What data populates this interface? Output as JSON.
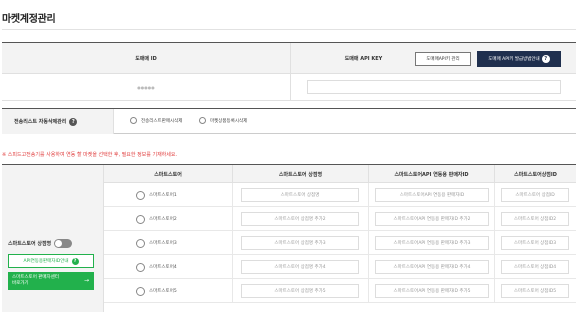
{
  "page": {
    "title": "마켓계정관리"
  },
  "domaemae": {
    "id_header": "도매매 ID",
    "apikey_header": "도매매 API KEY",
    "apikey_manage_button": "도매매API키 관리",
    "apikey_guide_button": "도매매 API키 발급방법안내",
    "id_value": "●●●●●",
    "apikey_value": ""
  },
  "auto_delete": {
    "label": "전송리스트 자동삭제관리",
    "options": [
      {
        "label": "전송리스트판매시삭제",
        "selected": false
      },
      {
        "label": "마켓상품등록시삭제",
        "selected": false
      }
    ]
  },
  "notice": "※ 스피드고전송기를 사용하여 연동 할 마켓을 선택한 후, 필요한 정보를 기재하세요.",
  "smartstore": {
    "headers": {
      "store": "스마트스토어",
      "shop_name": "스마트스토어 상점명",
      "seller_id": "스마트스토어API 연동용 판매자ID",
      "store_id": "스마트스토어상점ID"
    },
    "toggle_label": "스마트스토어 상점명",
    "toggle_on": false,
    "guide_button": "API연동용판매자ID안내",
    "go_button_line1": "스마트스토어 판매자센터",
    "go_button_line2": "바로가기",
    "go_button_arrow": "→",
    "rows": [
      {
        "store": "스마트스토어1",
        "shop_name": "스마트스토어 상점명",
        "seller_id": "스마트스토어API 연동용 판매자ID",
        "store_id": "스마트스토어 상점ID"
      },
      {
        "store": "스마트스토어2",
        "shop_name": "스마트스토어 상점명 추가2",
        "seller_id": "스마트스토어API 연동용 판매자ID 추가2",
        "store_id": "스마트스토어 상점ID2"
      },
      {
        "store": "스마트스토어3",
        "shop_name": "스마트스토어 상점명 추가3",
        "seller_id": "스마트스토어API 연동용 판매자ID 추가3",
        "store_id": "스마트스토어 상점ID3"
      },
      {
        "store": "스마트스토어4",
        "shop_name": "스마트스토어 상점명 추가4",
        "seller_id": "스마트스토어API 연동용 판매자ID 추가4",
        "store_id": "스마트스토어 상점ID4"
      },
      {
        "store": "스마트스토어5",
        "shop_name": "스마트스토어 상점명 추가5",
        "seller_id": "스마트스토어API 연동용 판매자ID 추가5",
        "store_id": "스마트스토어 상점ID5"
      }
    ]
  },
  "colors": {
    "navy": "#1f2f4e",
    "green": "#22b14c",
    "notice_red": "#e03c3c"
  },
  "icons": [
    "question-icon",
    "radio-icon",
    "toggle-switch",
    "arrow-right-icon"
  ]
}
